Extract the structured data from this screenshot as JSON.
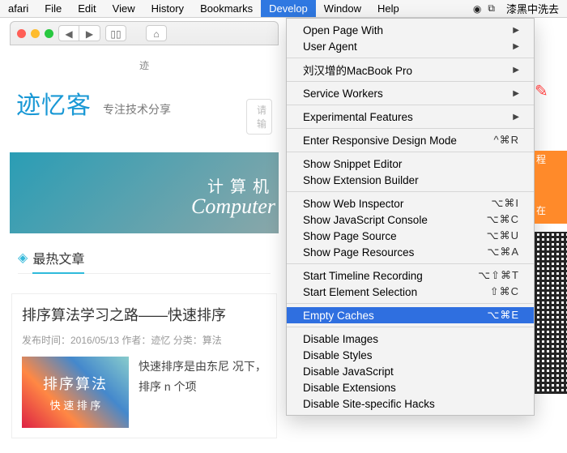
{
  "menubar": {
    "items": [
      "afari",
      "File",
      "Edit",
      "View",
      "History",
      "Bookmarks",
      "Develop",
      "Window",
      "Help"
    ],
    "active_index": 6,
    "right_text": "漆黑中洗去"
  },
  "dropdown": {
    "groups": [
      [
        {
          "label": "Open Page With",
          "submenu": true
        },
        {
          "label": "User Agent",
          "submenu": true
        }
      ],
      [
        {
          "label": "刘汉增的MacBook Pro",
          "submenu": true
        }
      ],
      [
        {
          "label": "Service Workers",
          "submenu": true
        }
      ],
      [
        {
          "label": "Experimental Features",
          "submenu": true
        }
      ],
      [
        {
          "label": "Enter Responsive Design Mode",
          "shortcut": "^⌘R"
        }
      ],
      [
        {
          "label": "Show Snippet Editor"
        },
        {
          "label": "Show Extension Builder"
        }
      ],
      [
        {
          "label": "Show Web Inspector",
          "shortcut": "⌥⌘I"
        },
        {
          "label": "Show JavaScript Console",
          "shortcut": "⌥⌘C"
        },
        {
          "label": "Show Page Source",
          "shortcut": "⌥⌘U"
        },
        {
          "label": "Show Page Resources",
          "shortcut": "⌥⌘A"
        }
      ],
      [
        {
          "label": "Start Timeline Recording",
          "shortcut": "⌥⇧⌘T"
        },
        {
          "label": "Start Element Selection",
          "shortcut": "⇧⌘C"
        }
      ],
      [
        {
          "label": "Empty Caches",
          "shortcut": "⌥⌘E",
          "selected": true
        }
      ],
      [
        {
          "label": "Disable Images"
        },
        {
          "label": "Disable Styles"
        },
        {
          "label": "Disable JavaScript"
        },
        {
          "label": "Disable Extensions"
        },
        {
          "label": "Disable Site-specific Hacks"
        }
      ]
    ]
  },
  "page": {
    "url_hint": "迹",
    "logo": "迹忆客",
    "tagline": "专注技术分享",
    "search_placeholder": "请输",
    "banner_zh": "计算机",
    "banner_en": "Computer",
    "hot_heading": "最热文章",
    "article": {
      "title": "排序算法学习之路——快速排序",
      "meta": "发布时间：2016/05/13 作者：迹忆 分类：算法",
      "thumb_cn": "排序算法",
      "thumb_en": "快 速 排 序",
      "desc": "快速排序是由东尼\n况下，排序 n 个项"
    }
  },
  "rstrip": {
    "tag1": "程",
    "tag2": "在"
  }
}
